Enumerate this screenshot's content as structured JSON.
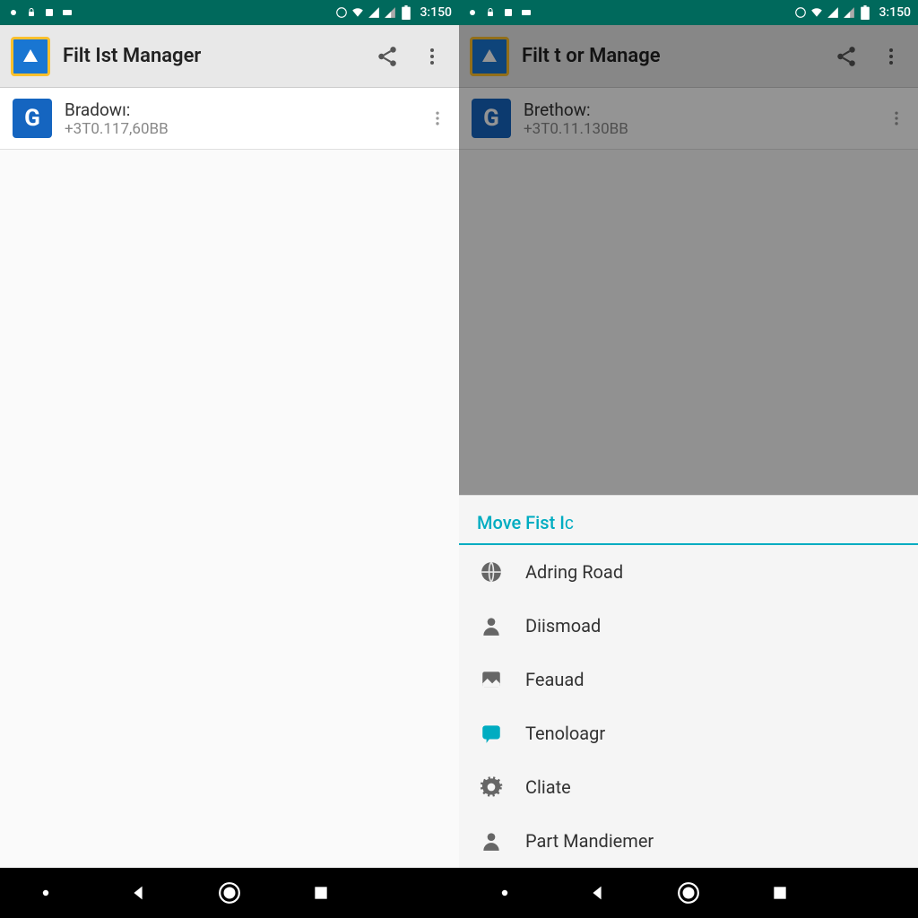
{
  "left": {
    "status": {
      "time": "3:150"
    },
    "appbar": {
      "title": "Filt Ist Manager"
    },
    "item": {
      "title": "Bradowı:",
      "sub": "+3T0.117,60BB"
    }
  },
  "right": {
    "status": {
      "time": "3:150"
    },
    "appbar": {
      "title": "Filt t or Manage"
    },
    "item": {
      "title": "Brethow:",
      "sub": "+3T0.11.130BB"
    },
    "sheet": {
      "title": "Move Fist Iϲ",
      "items": [
        {
          "icon": "globe",
          "label": "Adring Road"
        },
        {
          "icon": "person",
          "label": "Diismoad"
        },
        {
          "icon": "image",
          "label": "Feauad"
        },
        {
          "icon": "chat",
          "label": "Tenoloagr"
        },
        {
          "icon": "gear",
          "label": "Cliate"
        },
        {
          "icon": "person",
          "label": "Part Mandiemer"
        }
      ]
    }
  },
  "colors": {
    "teal": "#00695c",
    "accent": "#00acc1",
    "blue": "#1565c0"
  }
}
